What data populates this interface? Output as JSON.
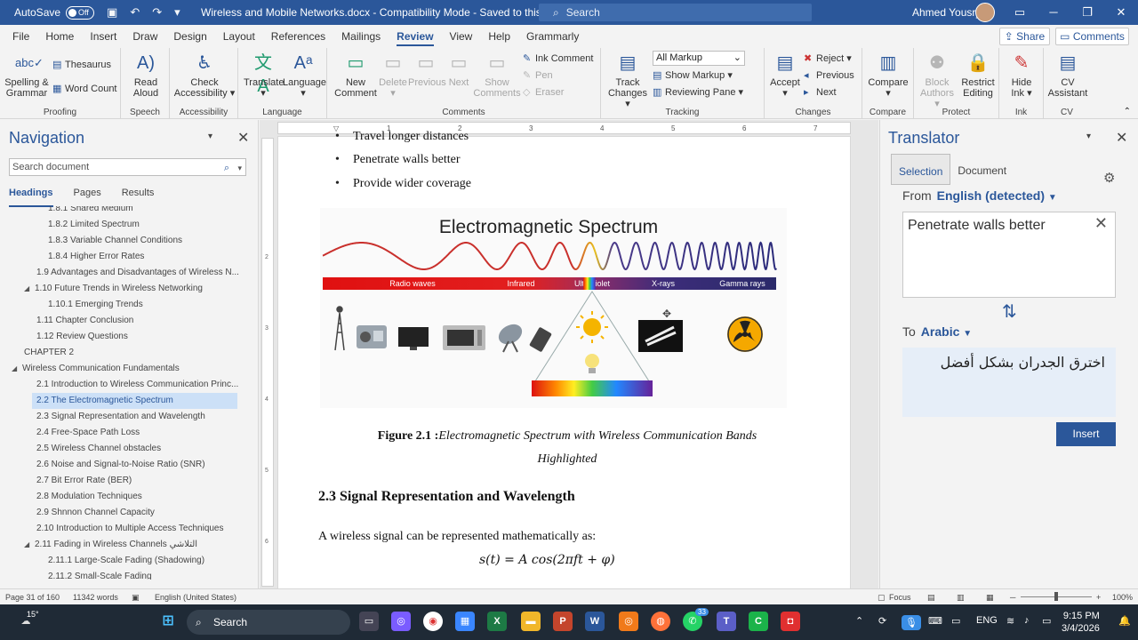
{
  "titlebar": {
    "autosave_label": "AutoSave",
    "autosave_state": "Off",
    "doc_title": "Wireless and Mobile Networks.docx  -  Compatibility Mode  -  Saved to this PC",
    "search_placeholder": "Search",
    "user_name": "Ahmed Yousry"
  },
  "menu": {
    "tabs": [
      "File",
      "Home",
      "Insert",
      "Draw",
      "Design",
      "Layout",
      "References",
      "Mailings",
      "Review",
      "View",
      "Help",
      "Grammarly"
    ],
    "active": "Review",
    "share": "Share",
    "comments": "Comments"
  },
  "ribbon": {
    "proofing": {
      "label": "Proofing",
      "spelling": "Spelling &",
      "grammar": "Grammar",
      "thesaurus": "Thesaurus",
      "word_count": "Word Count"
    },
    "speech": {
      "label": "Speech",
      "read": "Read",
      "aloud": "Aloud"
    },
    "accessibility": {
      "label": "Accessibility",
      "check": "Check",
      "access": "Accessibility"
    },
    "language": {
      "label": "Language",
      "translate": "Translate",
      "language": "Language"
    },
    "comments": {
      "label": "Comments",
      "new1": "New",
      "new2": "Comment",
      "delete": "Delete",
      "previous": "Previous",
      "next": "Next",
      "show1": "Show",
      "show2": "Comments",
      "ink": "Ink Comment",
      "pen": "Pen",
      "eraser": "Eraser"
    },
    "tracking": {
      "label": "Tracking",
      "track1": "Track",
      "track2": "Changes",
      "markup_value": "All Markup",
      "show_markup": "Show Markup",
      "reviewing_pane": "Reviewing Pane"
    },
    "changes": {
      "label": "Changes",
      "accept": "Accept",
      "reject": "Reject",
      "previous": "Previous",
      "next": "Next"
    },
    "compare": {
      "label": "Compare",
      "compare": "Compare"
    },
    "protect": {
      "label": "Protect",
      "block1": "Block",
      "block2": "Authors",
      "restrict1": "Restrict",
      "restrict2": "Editing"
    },
    "ink": {
      "label": "Ink",
      "hide1": "Hide",
      "hide2": "Ink"
    },
    "cv": {
      "label": "CV",
      "cv1": "CV",
      "cv2": "Assistant"
    }
  },
  "nav": {
    "title": "Navigation",
    "search_placeholder": "Search document",
    "tabs": [
      "Headings",
      "Pages",
      "Results"
    ],
    "items": [
      "1.8.1 Shared Medium",
      "1.8.2 Limited Spectrum",
      "1.8.3 Variable Channel Conditions",
      "1.8.4 Higher Error Rates",
      "1.9 Advantages and Disadvantages of Wireless N...",
      "1.10 Future Trends in Wireless Networking",
      "1.10.1 Emerging Trends",
      "1.11 Chapter Conclusion",
      "1.12 Review Questions",
      "CHAPTER 2",
      "Wireless Communication Fundamentals",
      "2.1 Introduction to Wireless Communication Princ...",
      "2.2 The Electromagnetic Spectrum",
      "2.3 Signal Representation and Wavelength",
      "2.4 Free-Space Path Loss",
      "2.5 Wireless Channel obstacles",
      "2.6 Noise and Signal-to-Noise Ratio (SNR)",
      "2.7 Bit Error Rate (BER)",
      "2.8 Modulation Techniques",
      "2.9 Shnnon Channel Capacity",
      "2.10 Introduction to Multiple Access Techniques",
      "2.11 Fading in Wireless Channels التلاشي",
      "2.11.1 Large-Scale Fading (Shadowing)",
      "2.11.2 Small-Scale Fading"
    ],
    "selected_index": 12
  },
  "document": {
    "top_cut": "Travel longer distances",
    "bullets": [
      "Penetrate walls better",
      "Provide wider coverage"
    ],
    "figure_title": "Electromagnetic Spectrum",
    "band_labels": [
      "Radio waves",
      "Infrared",
      "Ultraviolet",
      "X-rays",
      "Gamma rays"
    ],
    "caption_bold": "Figure 2.1 :",
    "caption_italic_1": "Electromagnetic Spectrum with Wireless Communication Bands",
    "caption_italic_2": "Highlighted",
    "heading": "2.3 Signal Representation and Wavelength",
    "paragraph": "A wireless signal can be represented mathematically as:",
    "formula": "s(t) = A cos(2πft + φ)"
  },
  "translator": {
    "title": "Translator",
    "tabs": [
      "Selection",
      "Document"
    ],
    "from_label": "From",
    "from_value": "English (detected)",
    "source_text": "Penetrate walls better",
    "to_label": "To",
    "to_value": "Arabic",
    "output_text": "اخترق الجدران بشكل أفضل",
    "insert": "Insert"
  },
  "status": {
    "page": "Page 31 of 160",
    "words": "11342 words",
    "language": "English (United States)",
    "focus": "Focus",
    "zoom": "100%"
  },
  "taskbar": {
    "search": "Search",
    "lang": "ENG",
    "time": "9:15 PM",
    "date": "3/4/2026",
    "weather": "15°",
    "badge": "33"
  },
  "colors": {
    "accent": "#2b579a",
    "selected": "#cce0f7",
    "taskbar": "#1f2a36"
  }
}
